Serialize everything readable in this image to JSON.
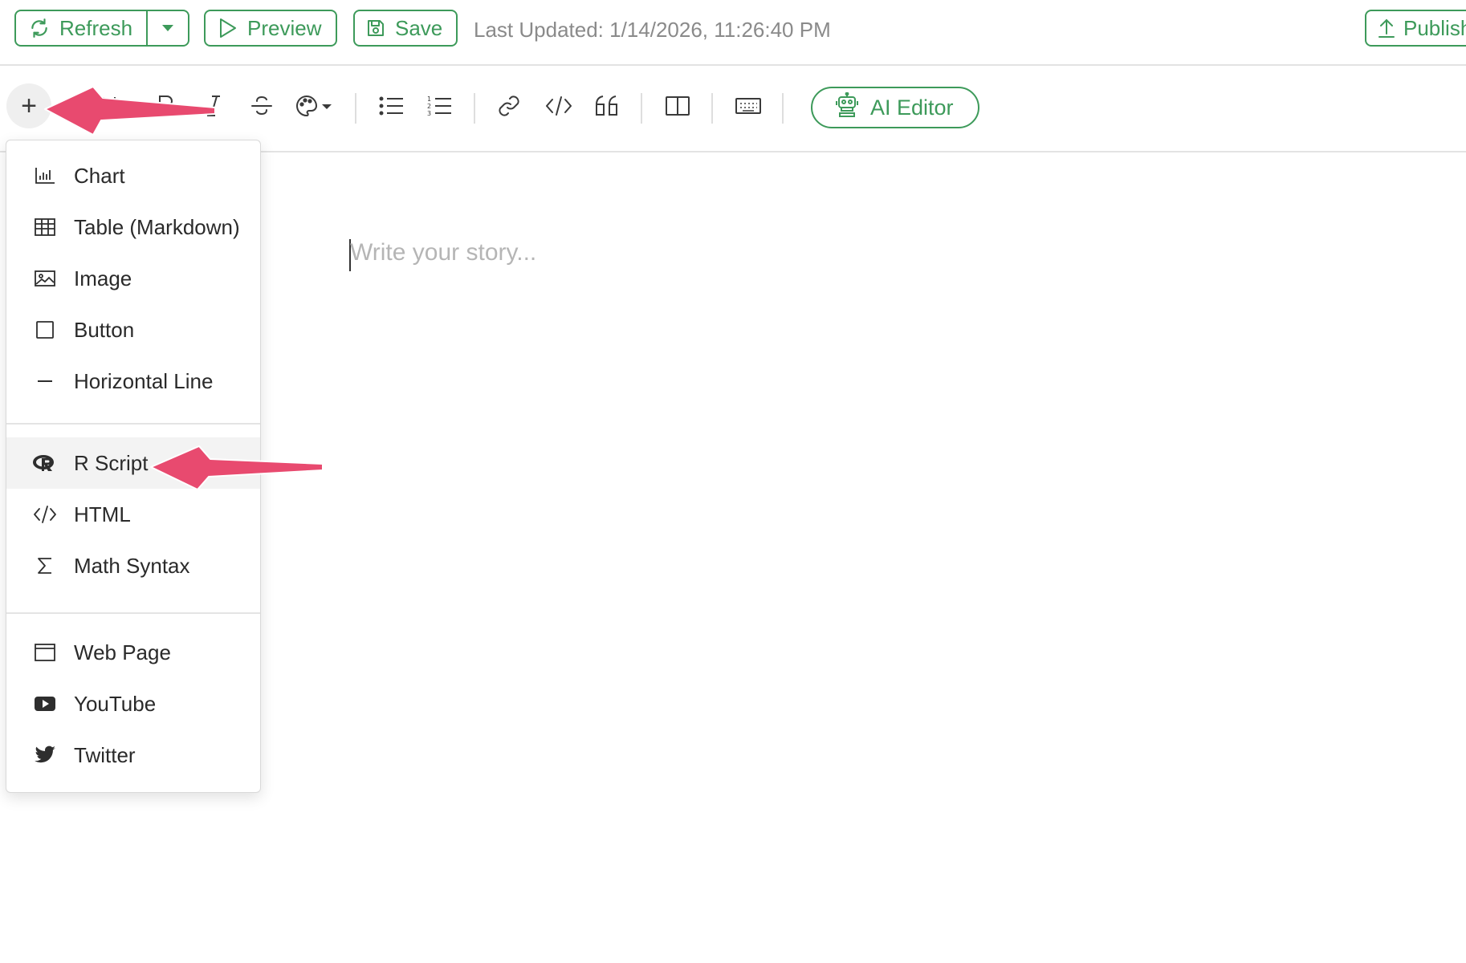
{
  "topbar": {
    "refresh_label": "Refresh",
    "preview_label": "Preview",
    "save_label": "Save",
    "last_updated": "Last Updated: 1/14/2026, 11:26:40 PM",
    "publish_label": "Publish"
  },
  "toolbar": {
    "add_label": "+",
    "tools": [
      "heading-icon",
      "bold-icon",
      "italic-icon",
      "strikethrough-icon",
      "color-palette-icon",
      "bullet-list-icon",
      "numbered-list-icon",
      "link-icon",
      "code-icon",
      "quote-icon",
      "columns-icon",
      "keyboard-icon"
    ],
    "ai_editor_label": "AI Editor"
  },
  "editor": {
    "placeholder": "Write your story..."
  },
  "menu": {
    "groups": [
      [
        {
          "label": "Chart",
          "icon": "bar-chart-icon"
        },
        {
          "label": "Table (Markdown)",
          "icon": "table-icon"
        },
        {
          "label": "Image",
          "icon": "image-icon"
        },
        {
          "label": "Button",
          "icon": "square-icon"
        },
        {
          "label": "Horizontal Line",
          "icon": "minus-icon"
        }
      ],
      [
        {
          "label": "R Script",
          "icon": "r-logo-icon",
          "active": true
        },
        {
          "label": "HTML",
          "icon": "code-icon"
        },
        {
          "label": "Math Syntax",
          "icon": "sigma-icon"
        }
      ],
      [
        {
          "label": "Web Page",
          "icon": "browser-window-icon"
        },
        {
          "label": "YouTube",
          "icon": "youtube-icon"
        },
        {
          "label": "Twitter",
          "icon": "twitter-icon"
        }
      ]
    ]
  },
  "colors": {
    "accent": "#3d9a5a",
    "annotation_arrow": "#e84a6f",
    "menu_active_bg": "#f3f3f3"
  }
}
